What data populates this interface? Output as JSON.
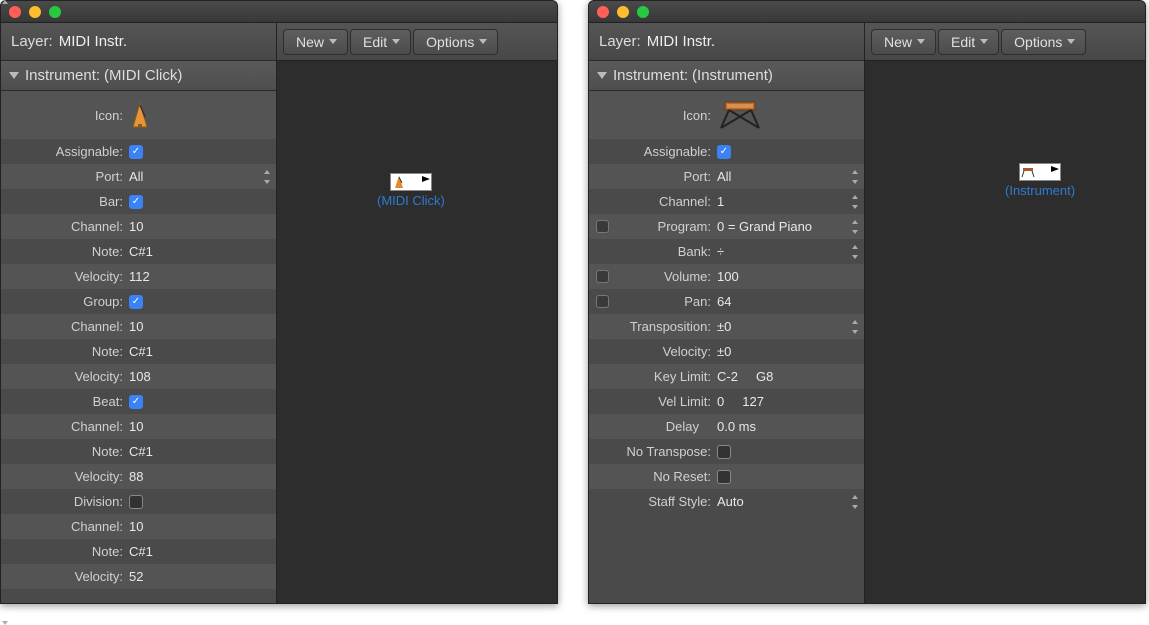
{
  "left": {
    "layer_prefix": "Layer:",
    "layer_value": "MIDI Instr.",
    "section_prefix": "Instrument:",
    "section_value": "(MIDI Click)",
    "toolbar": {
      "new": "New",
      "edit": "Edit",
      "options": "Options"
    },
    "node_label": "(MIDI Click)",
    "rows": [
      {
        "label": "Icon:",
        "type": "icon"
      },
      {
        "label": "Assignable:",
        "type": "check",
        "checked": true
      },
      {
        "label": "Port:",
        "type": "select",
        "value": "All"
      },
      {
        "label": "Bar:",
        "type": "check",
        "checked": true
      },
      {
        "label": "Channel:",
        "type": "text",
        "value": "10"
      },
      {
        "label": "Note:",
        "type": "text",
        "value": "C#1"
      },
      {
        "label": "Velocity:",
        "type": "text",
        "value": "112"
      },
      {
        "label": "Group:",
        "type": "check",
        "checked": true
      },
      {
        "label": "Channel:",
        "type": "text",
        "value": "10"
      },
      {
        "label": "Note:",
        "type": "text",
        "value": "C#1"
      },
      {
        "label": "Velocity:",
        "type": "text",
        "value": "108"
      },
      {
        "label": "Beat:",
        "type": "check",
        "checked": true
      },
      {
        "label": "Channel:",
        "type": "text",
        "value": "10"
      },
      {
        "label": "Note:",
        "type": "text",
        "value": "C#1"
      },
      {
        "label": "Velocity:",
        "type": "text",
        "value": "88"
      },
      {
        "label": "Division:",
        "type": "check",
        "checked": false
      },
      {
        "label": "Channel:",
        "type": "text",
        "value": "10"
      },
      {
        "label": "Note:",
        "type": "text",
        "value": "C#1"
      },
      {
        "label": "Velocity:",
        "type": "text",
        "value": "52"
      }
    ]
  },
  "right": {
    "layer_prefix": "Layer:",
    "layer_value": "MIDI Instr.",
    "section_prefix": "Instrument:",
    "section_value": "(Instrument)",
    "toolbar": {
      "new": "New",
      "edit": "Edit",
      "options": "Options"
    },
    "node_label": "(Instrument)",
    "rows": [
      {
        "label": "Icon:",
        "type": "icon-synth"
      },
      {
        "label": "Assignable:",
        "type": "check",
        "checked": true
      },
      {
        "label": "Port:",
        "type": "select",
        "value": "All"
      },
      {
        "label": "Channel:",
        "type": "select",
        "value": "1"
      },
      {
        "label": "Program:",
        "type": "select",
        "value": "0 = Grand Piano",
        "pre": true
      },
      {
        "label": "Bank:",
        "type": "select",
        "value": "÷"
      },
      {
        "label": "Volume:",
        "type": "text",
        "value": "100",
        "pre": true
      },
      {
        "label": "Pan:",
        "type": "text",
        "value": "64",
        "pre": true
      },
      {
        "label": "Transposition:",
        "type": "select",
        "value": "±0"
      },
      {
        "label": "Velocity:",
        "type": "text",
        "value": "±0"
      },
      {
        "label": "Key Limit:",
        "type": "range",
        "v1": "C-2",
        "v2": "G8"
      },
      {
        "label": "Vel Limit:",
        "type": "range",
        "v1": "0",
        "v2": "127"
      },
      {
        "label": "Delay",
        "type": "select-inline",
        "value": "0.0 ms"
      },
      {
        "label": "No Transpose:",
        "type": "check",
        "checked": false
      },
      {
        "label": "No Reset:",
        "type": "check",
        "checked": false
      },
      {
        "label": "Staff Style:",
        "type": "select",
        "value": "Auto"
      }
    ]
  }
}
